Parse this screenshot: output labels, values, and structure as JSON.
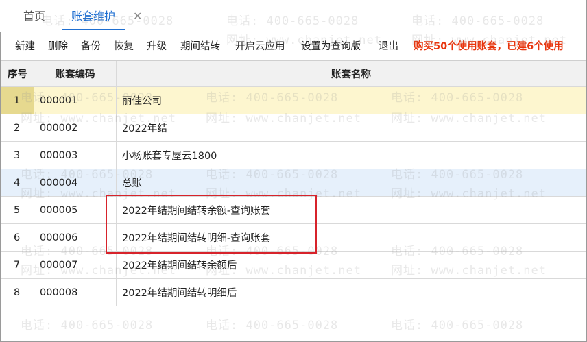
{
  "tabs": [
    {
      "label": "首页"
    },
    {
      "label": "账套维护",
      "close": "✕"
    }
  ],
  "toolbar": {
    "buttons": [
      "新建",
      "删除",
      "备份",
      "恢复",
      "升级",
      "期间结转",
      "开启云应用",
      "设置为查询版",
      "退出"
    ],
    "promo": "购买50个使用账套，已建6个使用"
  },
  "table": {
    "headers": [
      "序号",
      "账套编码",
      "账套名称"
    ],
    "rows": [
      {
        "idx": "1",
        "code": "000001",
        "name": "丽佳公司"
      },
      {
        "idx": "2",
        "code": "000002",
        "name": "2022年结"
      },
      {
        "idx": "3",
        "code": "000003",
        "name": "小杨账套专屋云1800"
      },
      {
        "idx": "4",
        "code": "000004",
        "name": "总账"
      },
      {
        "idx": "5",
        "code": "000005",
        "name": "2022年结期间结转余额-查询账套"
      },
      {
        "idx": "6",
        "code": "000006",
        "name": "2022年结期间结转明细-查询账套"
      },
      {
        "idx": "7",
        "code": "000007",
        "name": "2022年结期间结转余额后"
      },
      {
        "idx": "8",
        "code": "000008",
        "name": "2022年结期间结转明细后"
      }
    ]
  },
  "watermark": {
    "phone": "电话: 400-665-0028",
    "site": "网址: www.chanjet.net"
  },
  "colors": {
    "accent": "#1f6fd1",
    "promo": "#e8340c",
    "selected_row": "#fdf6cf",
    "hover_row": "#e6f0fb",
    "annotation": "#d7232b"
  }
}
